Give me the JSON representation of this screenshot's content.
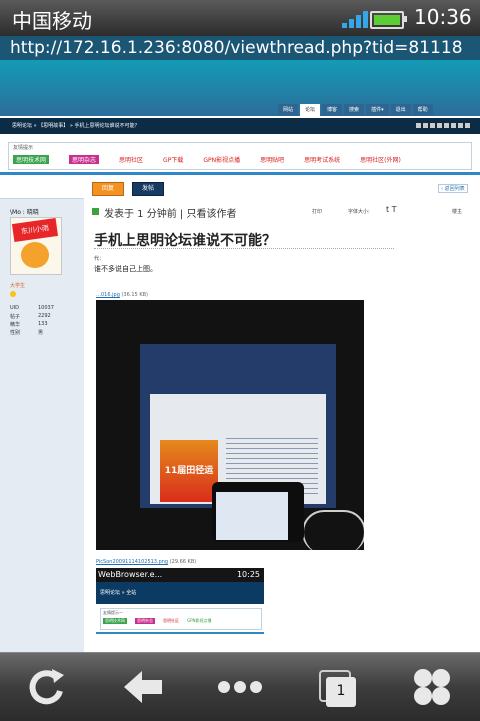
{
  "status_bar": {
    "carrier": "中国移动",
    "time": "10:36",
    "signal_icon": "signal-bars-icon",
    "battery_icon": "battery-icon"
  },
  "url": "http://172.16.1.236:8080/viewthread.php?tid=81118",
  "site": {
    "menu_items": [
      "网站",
      "论坛",
      "博客",
      "搜索",
      "插件▾",
      "退出",
      "帮助"
    ],
    "breadcrumb": "思明论坛 » 【思明故事】 » 手机上思明论坛谁说不可能？",
    "quick_box_title": "友情提示",
    "quick_links": [
      "思明技术网",
      "思明杂志",
      "思明社区",
      "GP下载",
      "GPN影视点播",
      "思明贴吧",
      "思明考试系统",
      "思明社区(外网)"
    ]
  },
  "post": {
    "reply_label": "回复",
    "new_post_label": "发帖",
    "back_label": "‹ 返回列表",
    "meta": "发表于 1 分钟前 | 只看该作者",
    "print_label": "打印",
    "font_label": "字体大小:",
    "font_T": "t T",
    "floor_label": "楼主",
    "title": "手机上思明论坛谁说不可能？",
    "intro": "代：",
    "body": "谁不多说自己上图。",
    "attachment1": {
      "name": "…016.jpg",
      "size": "(36.15 KB)"
    },
    "photo_banner": "11届田径运",
    "attachment2": {
      "name": "PicSon20091114102513.png",
      "size": "(29.66 KB)"
    },
    "inner_shot": {
      "app_title": "WebBrowser.e...",
      "time": "10:25",
      "header_text": "思明论坛 » 全站",
      "box_title": "友情提示一",
      "links": [
        "思明技术网",
        "思明杂志",
        "思明社区",
        "GPN影视点播"
      ]
    }
  },
  "author": {
    "name": "\\Mo : 晓晓",
    "avatar_text": "东川小雨",
    "rank": "大学生",
    "stats": [
      {
        "label": "UID",
        "value": "10037"
      },
      {
        "label": "帖子",
        "value": "2292"
      },
      {
        "label": "精华",
        "value": "133"
      },
      {
        "label": "性别",
        "value": "男"
      }
    ]
  },
  "toolbar": {
    "refresh_icon": "refresh-icon",
    "back_icon": "back-arrow-icon",
    "more_icon": "more-dots-icon",
    "tabs_icon": "tabs-icon",
    "tabs_count": "1",
    "menu_icon": "app-menu-icon"
  }
}
